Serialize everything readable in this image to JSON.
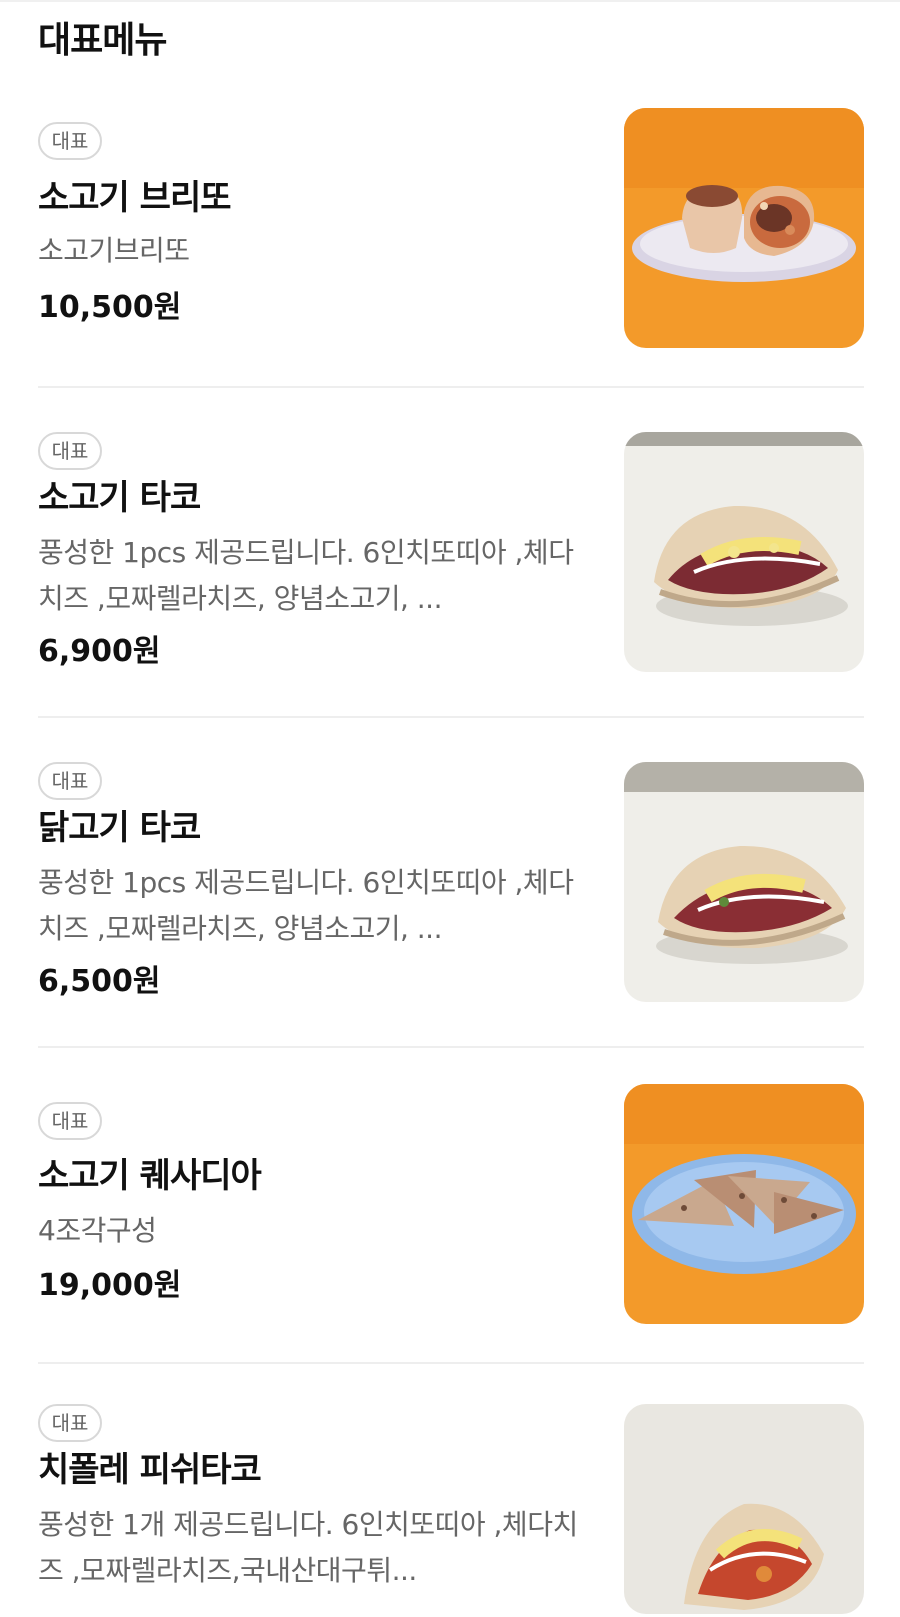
{
  "section": {
    "title": "대표메뉴"
  },
  "items": [
    {
      "badge": "대표",
      "name": "소고기 브리또",
      "description": "소고기브리또",
      "price": "10,500원",
      "image": "beef-burrito-photo",
      "image_bg": "#f39a2a"
    },
    {
      "badge": "대표",
      "name": "소고기 타코",
      "description": "풍성한 1pcs 제공드립니다. 6인치또띠아 ,체다치즈 ,모짜렐라치즈, 양념소고기, 그릴드어니언, 사워크림",
      "description_display": "풍성한 1pcs 제공드립니다. 6인치또띠아 ,체다치즈 ,모짜렐라치즈, 양념소고기, ...",
      "price": "6,900원",
      "image": "beef-taco-photo",
      "image_bg": "#efeee9"
    },
    {
      "badge": "대표",
      "name": "닭고기 타코",
      "description": "풍성한 1pcs 제공드립니다. 6인치또띠아 ,체다치즈 ,모짜렐라치즈, 양념소고기, ...",
      "price": "6,500원",
      "image": "chicken-taco-photo",
      "image_bg": "#efeee9"
    },
    {
      "badge": "대표",
      "name": "소고기 퀘사디아",
      "description": "4조각구성",
      "price": "19,000원",
      "image": "beef-quesadilla-photo",
      "image_bg": "#f39a2a"
    },
    {
      "badge": "대표",
      "name": "치폴레 피쉬타코",
      "description": "풍성한 1개 제공드립니다. 6인치또띠아 ,체다치즈 ,모짜렐라치즈,국내산대구튀...",
      "price": "",
      "image": "chipotle-fish-taco-photo",
      "image_bg": "#efeee9"
    }
  ]
}
